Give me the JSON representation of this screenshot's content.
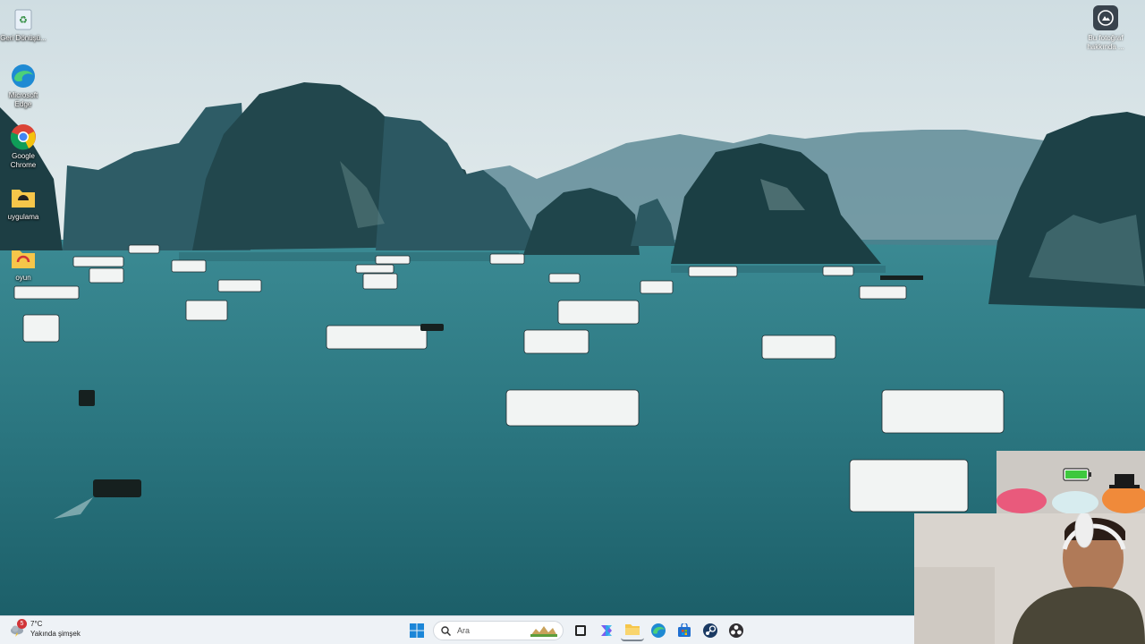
{
  "desktop": {
    "icons": [
      {
        "label": "Geri Dönüşü..."
      },
      {
        "label": "Microsoft Edge"
      },
      {
        "label": "Google Chrome"
      },
      {
        "label": "uygulama"
      },
      {
        "label": "oyun"
      }
    ],
    "spotlight": {
      "label": "Bu fotoğraf hakkında ..."
    }
  },
  "taskbar": {
    "weather": {
      "temperature": "7°C",
      "forecast": "Yakında şimşek",
      "badge": "5"
    },
    "search": {
      "placeholder": "Ara"
    },
    "apps": [
      "start-icon",
      "task-view-icon",
      "copilot-icon",
      "file-explorer-icon",
      "edge-icon",
      "store-icon",
      "steam-icon",
      "obs-icon"
    ]
  },
  "overlay": {
    "battery_color": "#3ec83e"
  },
  "colors": {
    "sky": "#d9e6ea",
    "water": "#2a7680",
    "karst": "#1f4f55"
  }
}
